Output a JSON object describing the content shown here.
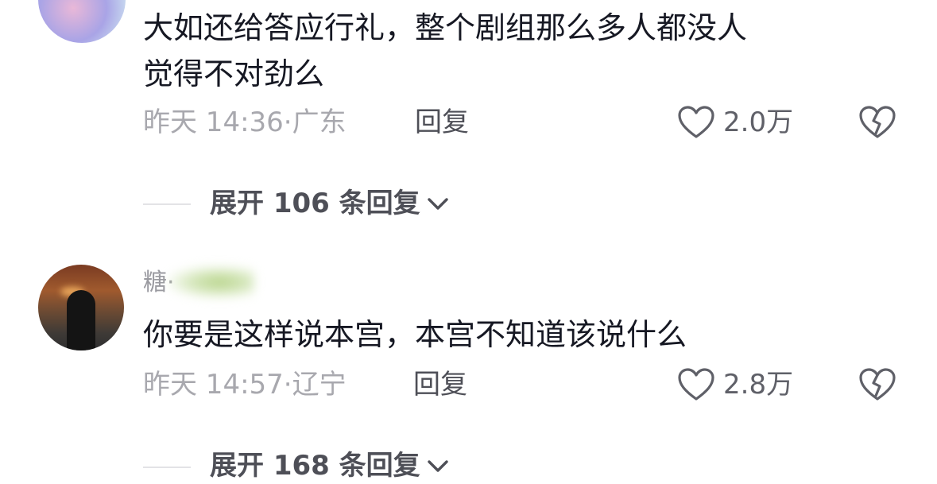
{
  "comments": [
    {
      "nickname": "",
      "text_line1": "大如还给答应行礼，整个剧组那么多人都没人",
      "text_line2": "觉得不对劲么",
      "time": "昨天 14:36",
      "sep": "·",
      "location": "广东",
      "reply_label": "回复",
      "likes": "2.0万",
      "expand_label": "展开 106 条回复"
    },
    {
      "nickname": "糖·",
      "text_line1": "你要是这样说本宫，本宫不知道该说什么",
      "text_line2": "",
      "time": "昨天 14:57",
      "sep": "·",
      "location": "辽宁",
      "reply_label": "回复",
      "likes": "2.8万",
      "expand_label": "展开 168 条回复"
    }
  ],
  "icons": {
    "like": "heart-outline-icon",
    "dislike": "broken-heart-icon",
    "expand": "chevron-down-icon"
  },
  "colors": {
    "text": "#161823",
    "meta": "#a8a8ae",
    "action": "#4e4f57"
  }
}
